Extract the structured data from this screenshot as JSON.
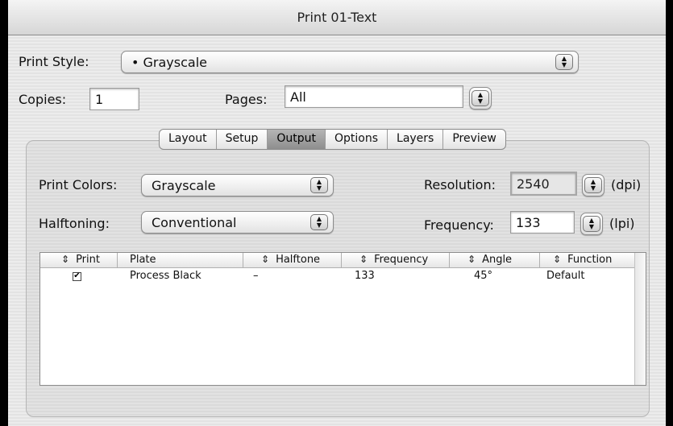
{
  "window": {
    "title": "Print 01-Text"
  },
  "print_style": {
    "label": "Print Style:",
    "value": "• Grayscale"
  },
  "copies": {
    "label": "Copies:",
    "value": "1"
  },
  "pages": {
    "label": "Pages:",
    "value": "All"
  },
  "tabs": [
    {
      "label": "Layout"
    },
    {
      "label": "Setup"
    },
    {
      "label": "Output",
      "active": true
    },
    {
      "label": "Options"
    },
    {
      "label": "Layers"
    },
    {
      "label": "Preview"
    }
  ],
  "output": {
    "print_colors": {
      "label": "Print Colors:",
      "value": "Grayscale"
    },
    "halftoning": {
      "label": "Halftoning:",
      "value": "Conventional"
    },
    "resolution": {
      "label": "Resolution:",
      "value": "2540",
      "unit": "(dpi)"
    },
    "frequency": {
      "label": "Frequency:",
      "value": "133",
      "unit": "(lpi)"
    }
  },
  "plates_table": {
    "columns": [
      "Print",
      "Plate",
      "Halftone",
      "Frequency",
      "Angle",
      "Function"
    ],
    "rows": [
      {
        "print": true,
        "plate": "Process Black",
        "halftone": "–",
        "frequency": "133",
        "angle": "45°",
        "function": "Default"
      }
    ]
  },
  "glyphs": {
    "sort": "⇕",
    "arrows": "▲▼",
    "check": "✔"
  }
}
